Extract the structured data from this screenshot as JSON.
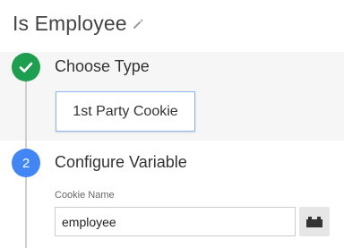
{
  "header": {
    "title": "Is Employee",
    "edit_icon": "pencil-icon"
  },
  "steps": [
    {
      "status": "done",
      "indicator": "checkmark-icon",
      "label": "Choose Type",
      "selected_type": "1st Party Cookie"
    },
    {
      "status": "active",
      "number": "2",
      "label": "Configure Variable",
      "field": {
        "label": "Cookie Name",
        "value": "employee",
        "variable_picker_icon": "lego-brick-icon"
      }
    }
  ],
  "colors": {
    "done": "#1e9e4f",
    "active": "#4285f4",
    "step_bg": "#f6f6f6",
    "selected_border": "#8ab4f0"
  }
}
